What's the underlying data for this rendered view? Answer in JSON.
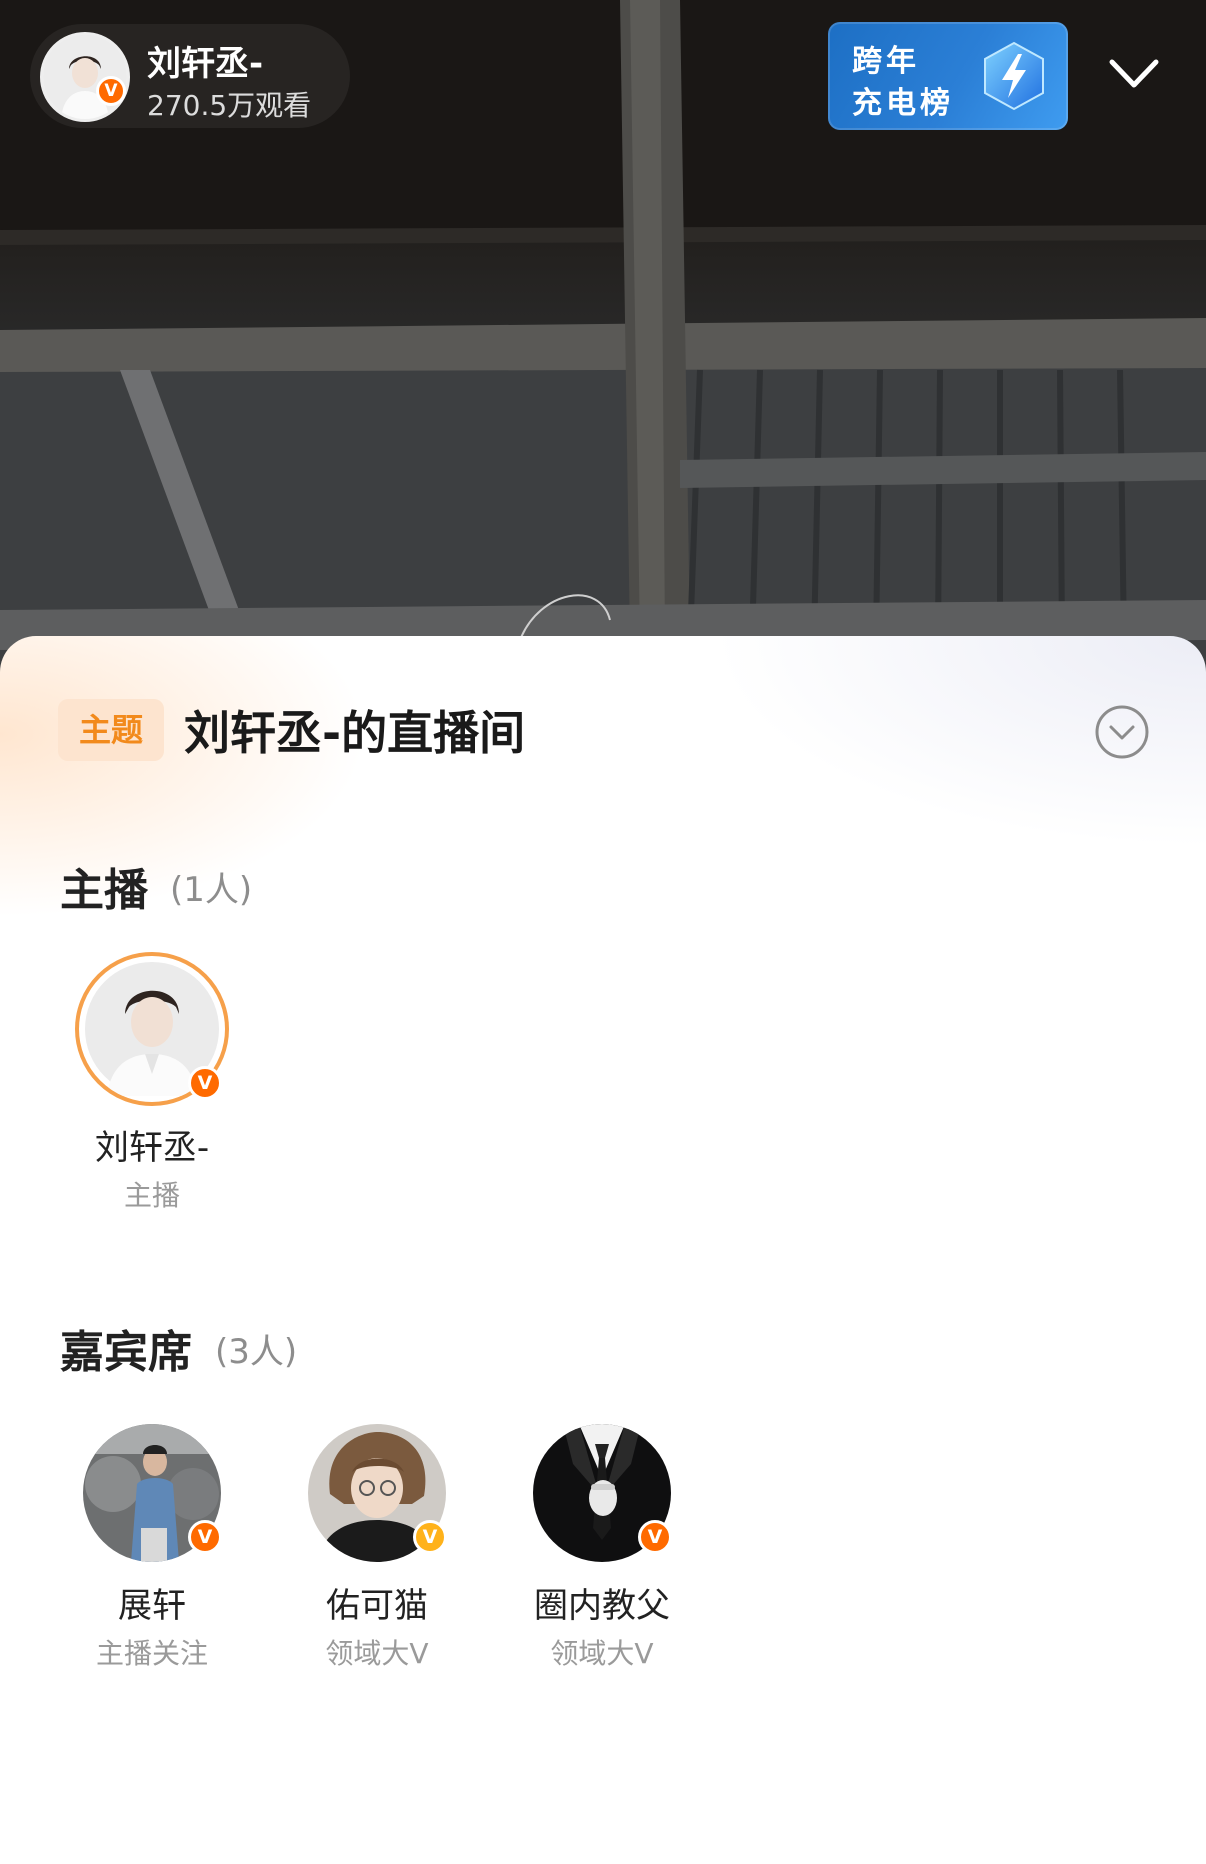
{
  "header": {
    "streamer_name": "刘轩丞-",
    "view_count": "270.5万观看",
    "rank_banner": {
      "line1": "跨年",
      "line2": "充电榜"
    }
  },
  "topic": {
    "tag": "主题",
    "title": "刘轩丞-的直播间"
  },
  "hosts": {
    "title": "主播",
    "count": "(1人)",
    "members": [
      {
        "name": "刘轩丞-",
        "role": "主播"
      }
    ]
  },
  "guests": {
    "title": "嘉宾席",
    "count": "(3人)",
    "members": [
      {
        "name": "展轩",
        "role": "主播关注"
      },
      {
        "name": "佑可猫",
        "role": "领域大V"
      },
      {
        "name": "圈内教父",
        "role": "领域大V"
      }
    ]
  },
  "colors": {
    "accent_orange": "#f28a1c",
    "badge_orange": "#ff6a00",
    "badge_gold": "#ffb21a",
    "rank_blue": "#2b7fd6"
  },
  "icons": [
    "verified-v-icon",
    "lightning-bolt-icon",
    "chevron-down-icon",
    "expand-circle-icon"
  ]
}
